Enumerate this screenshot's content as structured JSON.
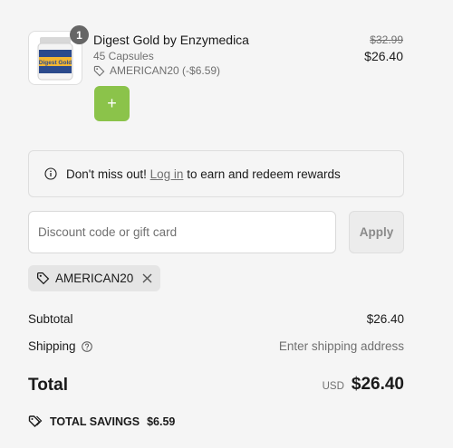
{
  "product": {
    "quantity": "1",
    "name": "Digest Gold by Enzymedica",
    "variant": "45 Capsules",
    "discount_line": "AMERICAN20 (-$6.59)",
    "original_price": "$32.99",
    "price": "$26.40",
    "image_label": "Digest Gold",
    "add_label": "+"
  },
  "notice": {
    "text_before": "Don't miss out!",
    "link": "Log in",
    "text_after": "to earn and redeem rewards"
  },
  "discount": {
    "placeholder": "Discount code or gift card",
    "apply_label": "Apply",
    "applied_code": "AMERICAN20"
  },
  "summary": {
    "subtotal_label": "Subtotal",
    "subtotal_value": "$26.40",
    "shipping_label": "Shipping",
    "shipping_value": "Enter shipping address",
    "total_label": "Total",
    "currency": "USD",
    "total_value": "$26.40",
    "savings_label": "TOTAL SAVINGS",
    "savings_value": "$6.59"
  },
  "colors": {
    "add_button": "#8bc34a",
    "badge": "#666666",
    "background": "#f5f5f5"
  }
}
